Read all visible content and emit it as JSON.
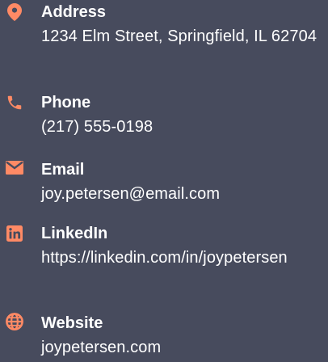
{
  "accent_color": "#ff8a65",
  "background_color": "#474b5d",
  "contacts": [
    {
      "icon": "map-pin-icon",
      "label": "Address",
      "value": "1234 Elm Street, Springfield, IL 62704"
    },
    {
      "icon": "phone-icon",
      "label": "Phone",
      "value": "(217) 555-0198"
    },
    {
      "icon": "envelope-icon",
      "label": "Email",
      "value": "joy.petersen@email.com"
    },
    {
      "icon": "linkedin-icon",
      "label": "LinkedIn",
      "value": "https://linkedin.com/in/joypetersen"
    },
    {
      "icon": "globe-icon",
      "label": "Website",
      "value": "joypetersen.com"
    }
  ]
}
